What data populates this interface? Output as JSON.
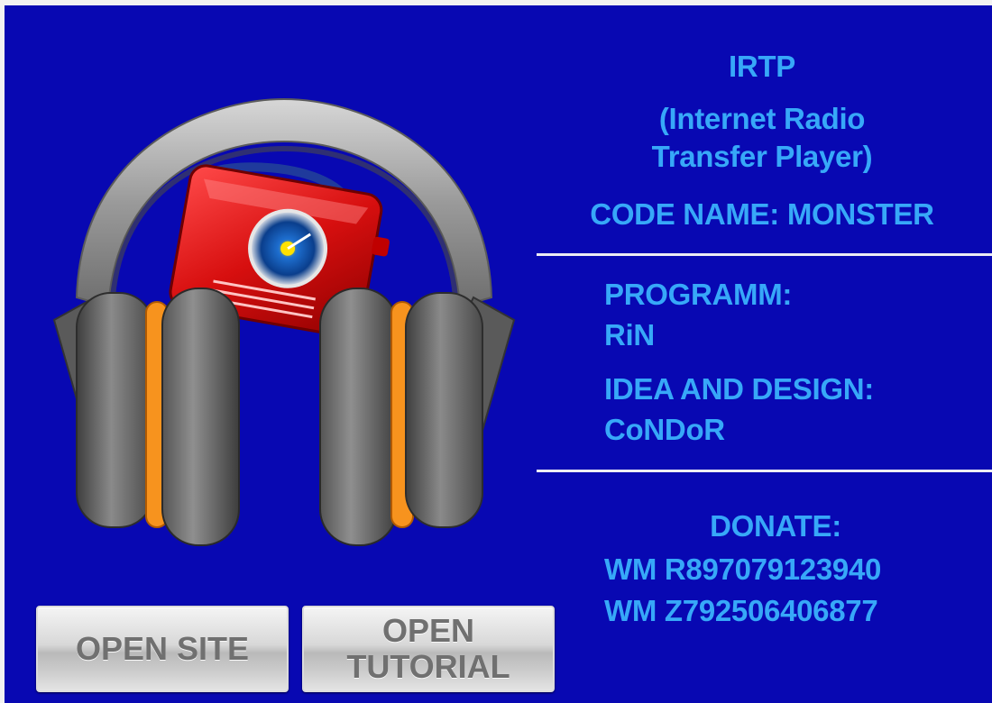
{
  "info": {
    "title": "IRTP",
    "subtitle_line1": "(Internet Radio",
    "subtitle_line2": "Transfer Player)",
    "code_name": "CODE NAME: MONSTER",
    "program_label": "PROGRAMM:",
    "program_value": "RiN",
    "design_label": "IDEA AND DESIGN:",
    "design_value": "CoNDoR",
    "donate_label": "DONATE:",
    "wallet_r": "WM R897079123940",
    "wallet_z": "WM Z792506406877"
  },
  "buttons": {
    "open_site": "OPEN SITE",
    "open_tutorial_line1": "OPEN",
    "open_tutorial_line2": "TUTORIAL"
  },
  "colors": {
    "background": "#0808b2",
    "text": "#37a8f8",
    "divider": "#ececf4",
    "button_text": "#707070"
  },
  "icons": {
    "logo": "headphones-radio-icon"
  }
}
